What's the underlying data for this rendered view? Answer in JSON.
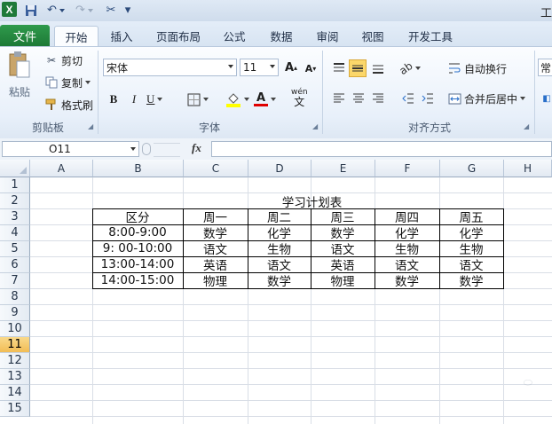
{
  "titlebar": {
    "title": "工"
  },
  "tabs": [
    "文件",
    "开始",
    "插入",
    "页面布局",
    "公式",
    "数据",
    "审阅",
    "视图",
    "开发工具"
  ],
  "clipboard": {
    "paste": "粘贴",
    "cut": "剪切",
    "copy": "复制",
    "format_painter": "格式刷",
    "label": "剪贴板"
  },
  "font": {
    "name": "宋体",
    "size": "11",
    "label": "字体",
    "bold": "B",
    "italic": "I",
    "underline": "U",
    "phonetic": "wén"
  },
  "alignment": {
    "wrap": "自动换行",
    "merge": "合并后居中",
    "label": "对齐方式"
  },
  "number": {
    "format_partial": "常"
  },
  "formula_bar": {
    "cell_ref": "O11",
    "fx": "fx",
    "value": ""
  },
  "columns": [
    "A",
    "B",
    "C",
    "D",
    "E",
    "F",
    "G",
    "H"
  ],
  "rows": [
    "1",
    "2",
    "3",
    "4",
    "5",
    "6",
    "7",
    "8",
    "9",
    "10",
    "11",
    "12",
    "13",
    "14",
    "15"
  ],
  "active_row": "11",
  "sheet": {
    "title": "学习计划表",
    "header": [
      "区分",
      "周一",
      "周二",
      "周三",
      "周四",
      "周五"
    ],
    "body": [
      [
        "8:00-9:00",
        "数学",
        "化学",
        "数学",
        "化学",
        "化学"
      ],
      [
        "9: 00-10:00",
        "语文",
        "生物",
        "语文",
        "生物",
        "生物"
      ],
      [
        "13:00-14:00",
        "英语",
        "语文",
        "英语",
        "语文",
        "语文"
      ],
      [
        "14:00-15:00",
        "物理",
        "数学",
        "物理",
        "数学",
        "数学"
      ]
    ]
  }
}
